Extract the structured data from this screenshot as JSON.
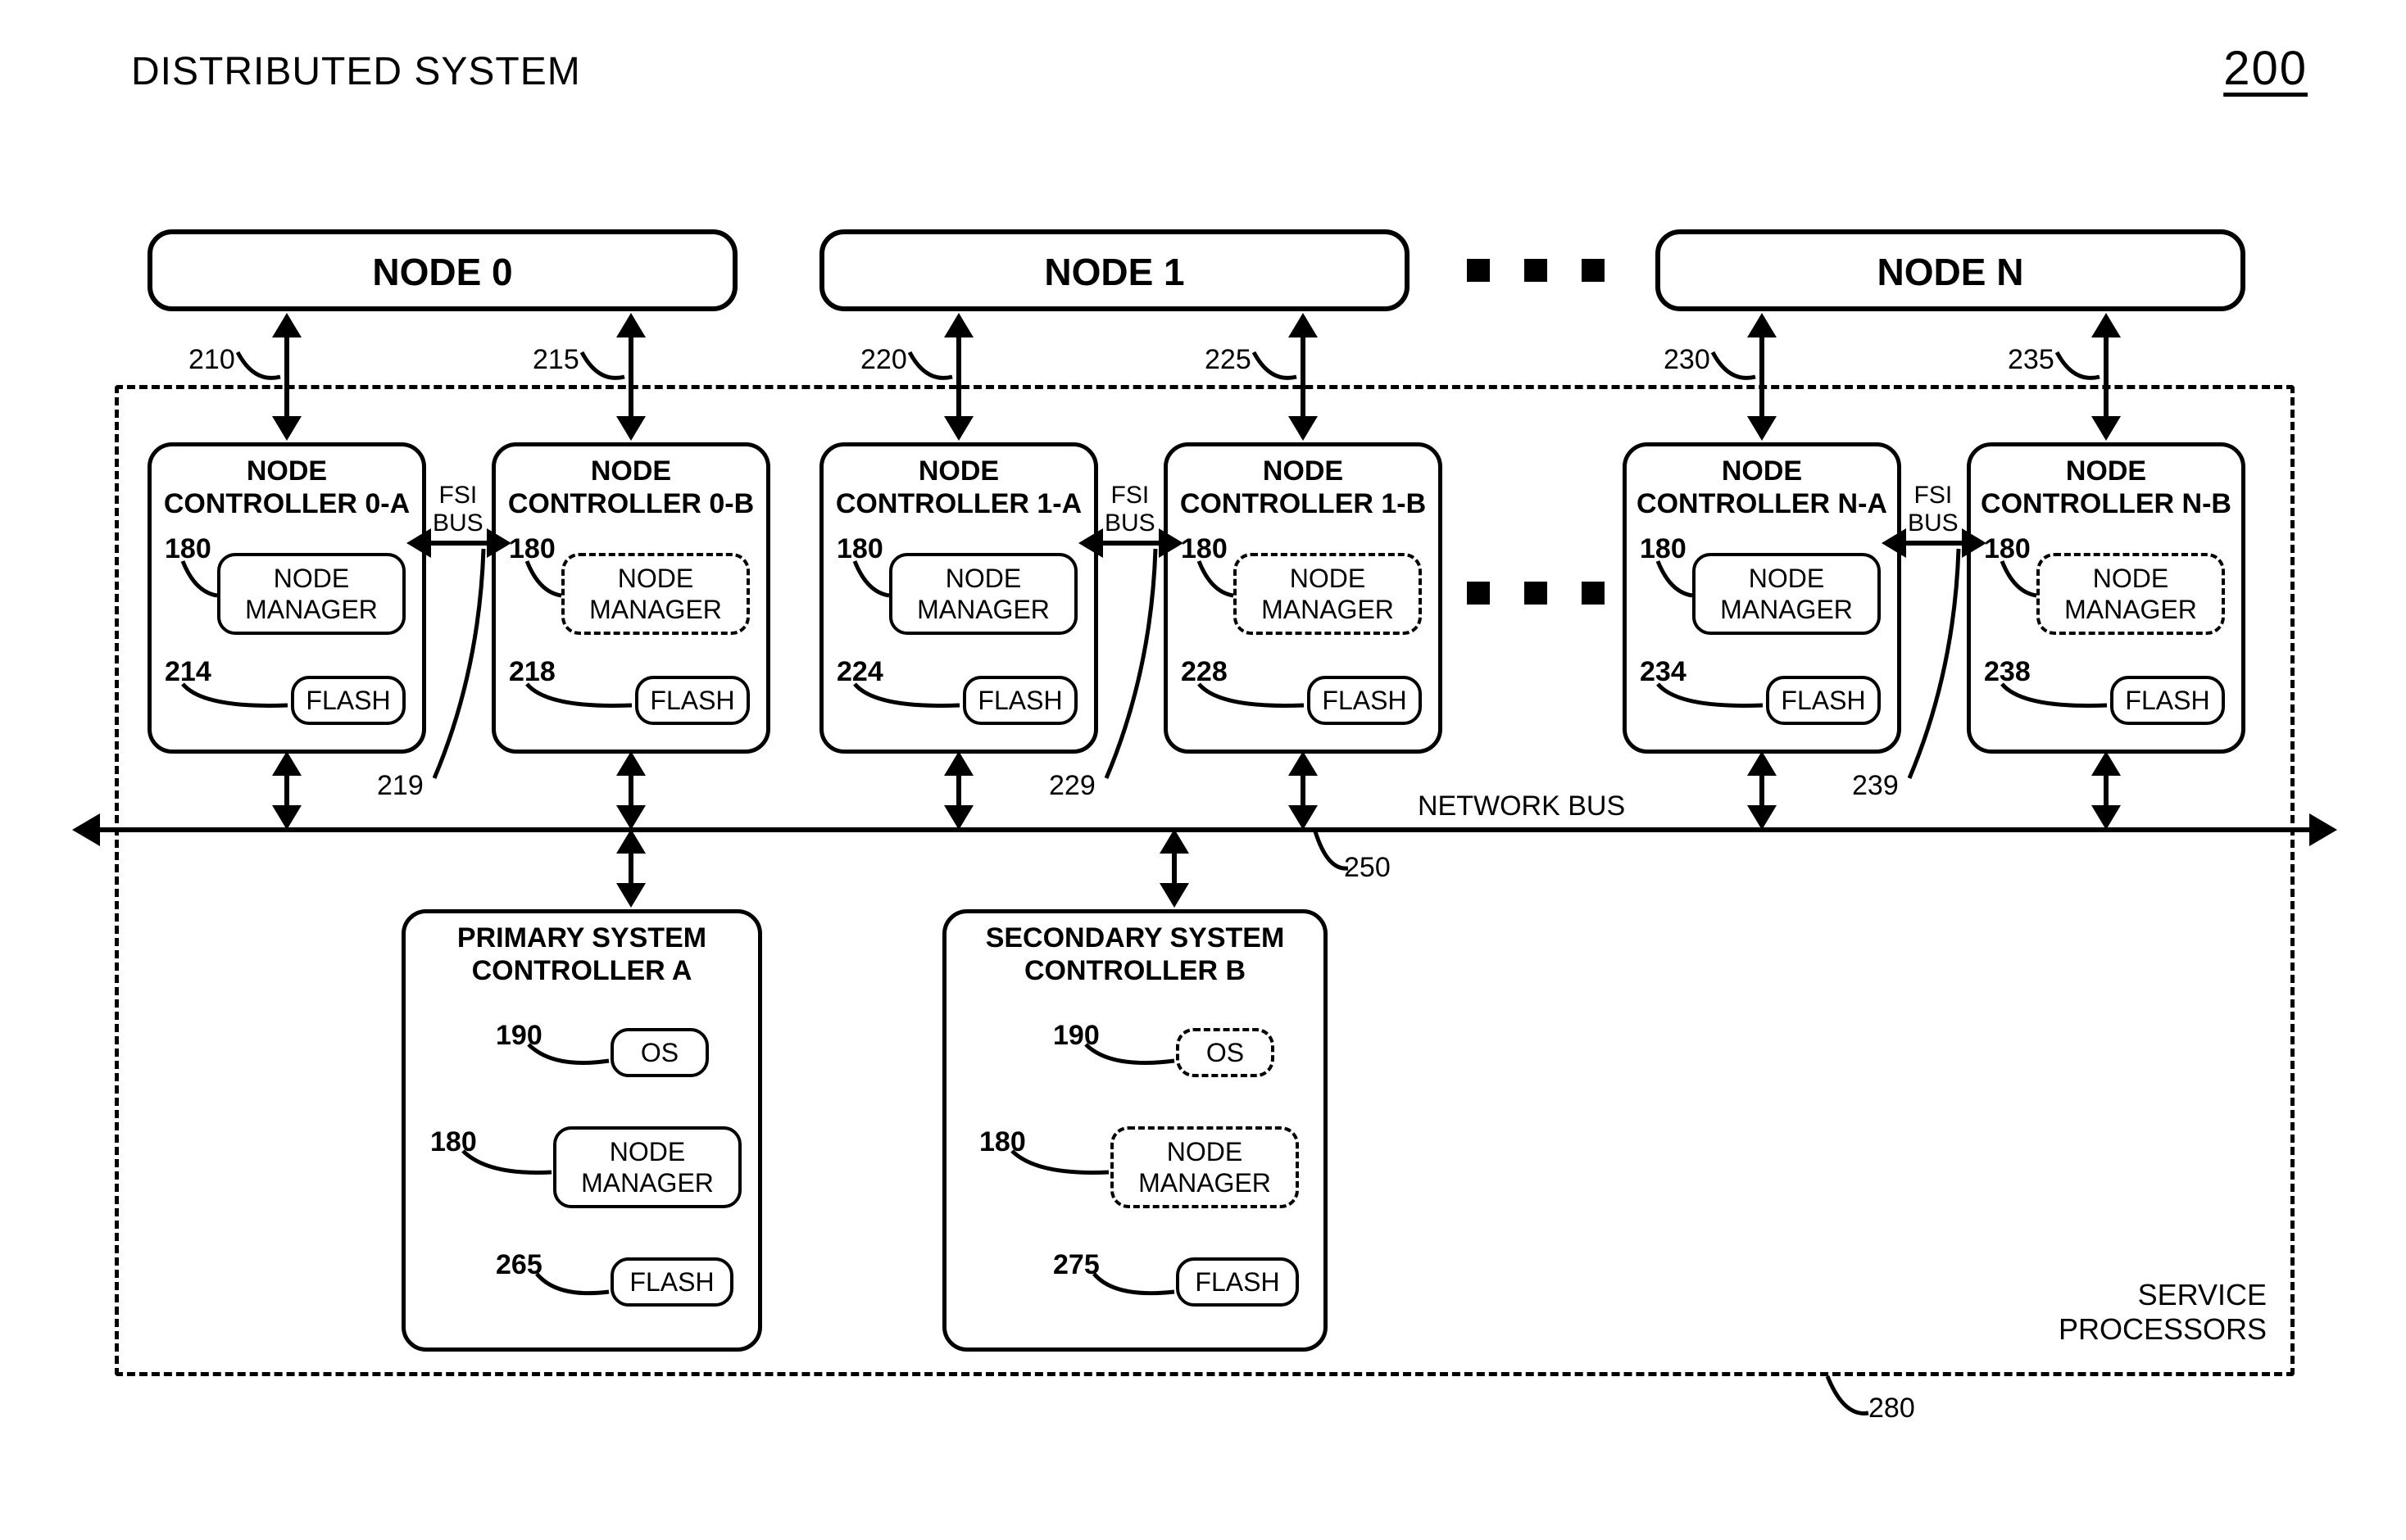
{
  "title": "DISTRIBUTED SYSTEM",
  "figure_number": "200",
  "bus_label": "NETWORK BUS",
  "bus_ref": "250",
  "outer_label_line1": "SERVICE",
  "outer_label_line2": "PROCESSORS",
  "outer_ref": "280",
  "dots": "■ ■ ■",
  "nodes": {
    "n0": "NODE 0",
    "n1": "NODE 1",
    "nN": "NODE N"
  },
  "ctrl": {
    "c0a": {
      "title_l1": "NODE",
      "title_l2": "CONTROLLER 0-A",
      "nm_ref": "180",
      "flash_ref": "214",
      "nm": "NODE\nMANAGER",
      "flash": "FLASH",
      "nm_dashed": false,
      "arrow_ref": "210"
    },
    "c0b": {
      "title_l1": "NODE",
      "title_l2": "CONTROLLER 0-B",
      "nm_ref": "180",
      "flash_ref": "218",
      "nm": "NODE\nMANAGER",
      "flash": "FLASH",
      "nm_dashed": true,
      "arrow_ref": "215"
    },
    "c1a": {
      "title_l1": "NODE",
      "title_l2": "CONTROLLER 1-A",
      "nm_ref": "180",
      "flash_ref": "224",
      "nm": "NODE\nMANAGER",
      "flash": "FLASH",
      "nm_dashed": false,
      "arrow_ref": "220"
    },
    "c1b": {
      "title_l1": "NODE",
      "title_l2": "CONTROLLER 1-B",
      "nm_ref": "180",
      "flash_ref": "228",
      "nm": "NODE\nMANAGER",
      "flash": "FLASH",
      "nm_dashed": true,
      "arrow_ref": "225"
    },
    "cNa": {
      "title_l1": "NODE",
      "title_l2": "CONTROLLER N-A",
      "nm_ref": "180",
      "flash_ref": "234",
      "nm": "NODE\nMANAGER",
      "flash": "FLASH",
      "nm_dashed": false,
      "arrow_ref": "230"
    },
    "cNb": {
      "title_l1": "NODE",
      "title_l2": "CONTROLLER N-B",
      "nm_ref": "180",
      "flash_ref": "238",
      "nm": "NODE\nMANAGER",
      "flash": "FLASH",
      "nm_dashed": true,
      "arrow_ref": "235"
    }
  },
  "fsi": {
    "label_l1": "FSI",
    "label_l2": "BUS",
    "ref0": "219",
    "ref1": "229",
    "refN": "239"
  },
  "sys": {
    "a": {
      "title_l1": "PRIMARY SYSTEM",
      "title_l2": "CONTROLLER A",
      "os_ref": "190",
      "os": "OS",
      "nm_ref": "180",
      "nm": "NODE\nMANAGER",
      "flash_ref": "265",
      "flash": "FLASH",
      "dashed": false
    },
    "b": {
      "title_l1": "SECONDARY SYSTEM",
      "title_l2": "CONTROLLER B",
      "os_ref": "190",
      "os": "OS",
      "nm_ref": "180",
      "nm": "NODE\nMANAGER",
      "flash_ref": "275",
      "flash": "FLASH",
      "dashed": true
    }
  }
}
